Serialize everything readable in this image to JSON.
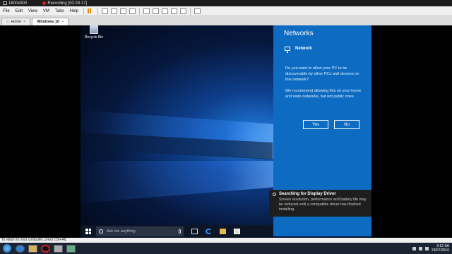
{
  "recorder": {
    "resolution": "1600x900",
    "recording": "Recording [00:28:17]"
  },
  "menu": [
    "File",
    "Edit",
    "View",
    "VM",
    "Tabs",
    "Help"
  ],
  "tabs": [
    {
      "label": "Home"
    },
    {
      "label": "Windows 10",
      "active": true
    }
  ],
  "desktop": {
    "recycle_bin": "Recycle Bin"
  },
  "networks": {
    "title": "Networks",
    "network_name": "Network",
    "question": "Do you want to allow your PC to be discoverable by other PCs and devices on this network?",
    "recommendation": "We recommend allowing this on your home and work networks, but not public ones.",
    "yes": "Yes",
    "no": "No"
  },
  "toast": {
    "title": "Searching for Display Driver",
    "body": "Screen resolution, performance and battery life may be reduced until a compatible driver has finished installing."
  },
  "taskbar": {
    "search_placeholder": "Ask me anything"
  },
  "status": "To return to your computer, press Ctrl+Alt.",
  "host_clock": {
    "time": "3:12 SA",
    "date": "23/07/2016"
  },
  "colors": {
    "flyout": "#0d6cc2",
    "toast": "#1e1e1e"
  }
}
